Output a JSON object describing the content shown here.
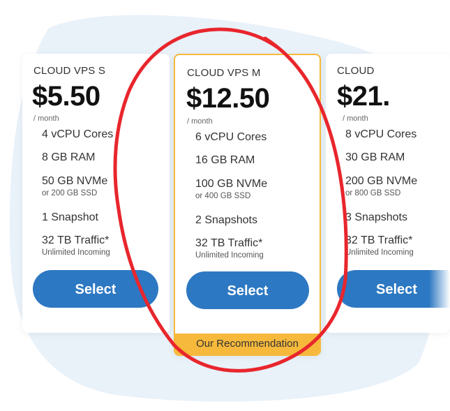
{
  "plans": [
    {
      "name": "CLOUD VPS S",
      "price": "$5.50",
      "period": "/ month",
      "features": [
        {
          "main": "4 vCPU Cores",
          "sub": ""
        },
        {
          "main": "8 GB RAM",
          "sub": ""
        },
        {
          "main": "50 GB NVMe",
          "sub": "or 200 GB SSD"
        },
        {
          "main": "1 Snapshot",
          "sub": ""
        },
        {
          "main": "32 TB Traffic*",
          "sub": "Unlimited Incoming"
        }
      ],
      "button": "Select"
    },
    {
      "name": "CLOUD VPS M",
      "price": "$12.50",
      "period": "/ month",
      "features": [
        {
          "main": "6 vCPU Cores",
          "sub": ""
        },
        {
          "main": "16 GB RAM",
          "sub": ""
        },
        {
          "main": "100 GB NVMe",
          "sub": "or 400 GB SSD"
        },
        {
          "main": "2 Snapshots",
          "sub": ""
        },
        {
          "main": "32 TB Traffic*",
          "sub": "Unlimited Incoming"
        }
      ],
      "button": "Select",
      "badge": "Our Recommendation"
    },
    {
      "name": "CLOUD",
      "price": "$21.",
      "period": "/ month",
      "features": [
        {
          "main": "8 vCPU Cores",
          "sub": ""
        },
        {
          "main": "30 GB RAM",
          "sub": ""
        },
        {
          "main": "200 GB NVMe",
          "sub": "or 800 GB SSD"
        },
        {
          "main": "3 Snapshots",
          "sub": ""
        },
        {
          "main": "32 TB Traffic*",
          "sub": "Unlimited Incoming"
        }
      ],
      "button": "Select"
    }
  ],
  "colors": {
    "accent_blue": "#2d78c2",
    "highlight_orange": "#f6b93b",
    "annotation_red": "#e8262c",
    "background_blob": "#e8f0f8"
  }
}
